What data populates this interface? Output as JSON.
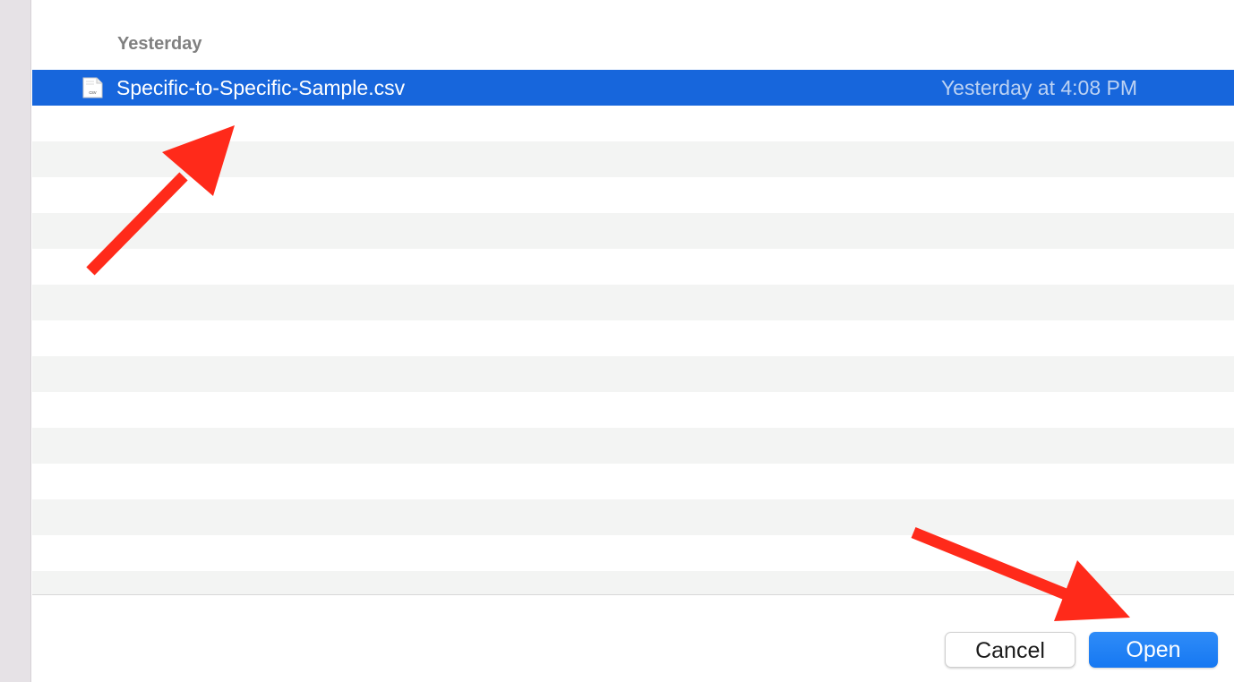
{
  "file_list": {
    "section_header": "Yesterday",
    "files": [
      {
        "icon": "csv-file-icon",
        "icon_label": "csv",
        "name": "Specific-to-Specific-Sample.csv",
        "date_modified": "Yesterday at 4:08 PM",
        "selected": true
      }
    ]
  },
  "footer": {
    "cancel_label": "Cancel",
    "open_label": "Open"
  },
  "colors": {
    "selection": "#1766dc",
    "open_button": "#1a7cf5",
    "annotation_arrow": "#ff2a1a",
    "row_stripe": "#f3f4f3",
    "sidebar": "#e6e2e6"
  },
  "annotations": [
    {
      "type": "arrow",
      "color": "#ff2a1a",
      "points_to": "selected-file-row"
    },
    {
      "type": "arrow",
      "color": "#ff2a1a",
      "points_to": "open-button"
    }
  ]
}
